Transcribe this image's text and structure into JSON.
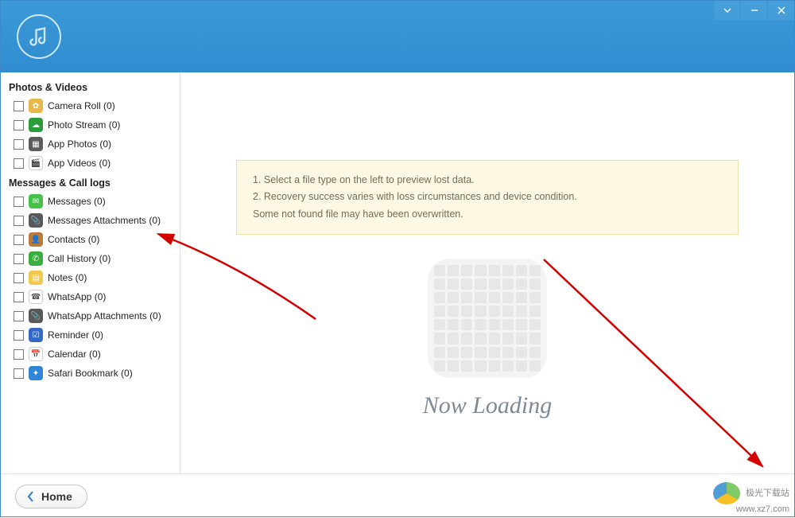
{
  "titlebar": {
    "controls": {
      "dropdown": "▾",
      "minimize": "—",
      "close": "✕"
    }
  },
  "sidebar": {
    "sections": [
      {
        "title": "Photos & Videos",
        "items": [
          {
            "label": "Camera Roll (0)",
            "icon_bg": "#e8b84b",
            "glyph": "✿"
          },
          {
            "label": "Photo Stream (0)",
            "icon_bg": "#2a9d3a",
            "glyph": "☁"
          },
          {
            "label": "App Photos (0)",
            "icon_bg": "#5c5c5c",
            "glyph": "▦"
          },
          {
            "label": "App Videos (0)",
            "icon_bg": "#ffffff",
            "glyph": "🎬"
          }
        ]
      },
      {
        "title": "Messages & Call logs",
        "items": [
          {
            "label": "Messages (0)",
            "icon_bg": "#46c24a",
            "glyph": "✉"
          },
          {
            "label": "Messages Attachments (0)",
            "icon_bg": "#595959",
            "glyph": "📎"
          },
          {
            "label": "Contacts (0)",
            "icon_bg": "#b97a3b",
            "glyph": "👤"
          },
          {
            "label": "Call History (0)",
            "icon_bg": "#3aae3e",
            "glyph": "✆"
          },
          {
            "label": "Notes (0)",
            "icon_bg": "#f2c94c",
            "glyph": "▤"
          },
          {
            "label": "WhatsApp (0)",
            "icon_bg": "#ffffff",
            "glyph": "☎"
          },
          {
            "label": "WhatsApp Attachments (0)",
            "icon_bg": "#595959",
            "glyph": "📎"
          },
          {
            "label": "Reminder (0)",
            "icon_bg": "#3469c7",
            "glyph": "☑"
          },
          {
            "label": "Calendar (0)",
            "icon_bg": "#ffffff",
            "glyph": "📅"
          },
          {
            "label": "Safari Bookmark (0)",
            "icon_bg": "#2f86d6",
            "glyph": "✦"
          }
        ]
      }
    ]
  },
  "info": {
    "line1": "1. Select a file type on the left to preview lost data.",
    "line2": "2. Recovery success varies with loss circumstances and device condition.",
    "line3": "Some not found file may have been overwritten."
  },
  "loading_text": "Now Loading",
  "footer": {
    "home_label": "Home"
  },
  "watermark": {
    "name": "极光下载站",
    "url": "www.xz7.com"
  }
}
